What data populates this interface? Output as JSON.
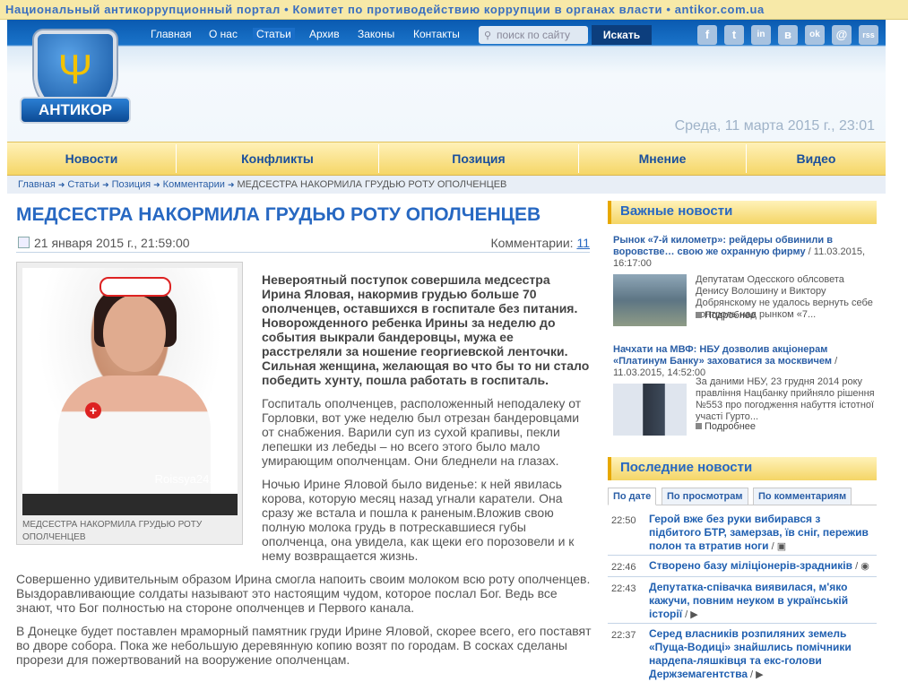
{
  "topstrip": "Национальный антикоррупционный портал • Комитет по противодействию коррупции в органах власти • antikor.com.ua",
  "nav": {
    "items": [
      "Главная",
      "О нас",
      "Статьи",
      "Архив",
      "Законы",
      "Контакты"
    ],
    "active": "Статьи"
  },
  "search": {
    "placeholder": "поиск по сайту",
    "button": "Искать"
  },
  "social": [
    "f",
    "t",
    "in",
    "в",
    "ok",
    "@",
    "rss"
  ],
  "logo": {
    "text": "АНТИКОР"
  },
  "datetime": "Среда, 11 марта 2015 г., 23:01",
  "mainnav": [
    "Новости",
    "Конфликты",
    "Позиция",
    "Мнение",
    "Видео"
  ],
  "breadcrumb": [
    "Главная",
    "Статьи",
    "Позиция",
    "Комментарии",
    "МЕДСЕСТРА НАКОРМИЛА ГРУДЬЮ РОТУ ОПОЛЧЕНЦЕВ"
  ],
  "article": {
    "title": "МЕДСЕСТРА НАКОРМИЛА ГРУДЬЮ РОТУ ОПОЛЧЕНЦЕВ",
    "date": "21 января 2015 г., 21:59:00",
    "comments_label": "Комментарии:",
    "comments_count": "11",
    "photo_watermark": "Roissya24.net",
    "photo_caption": "МЕДСЕСТРА НАКОРМИЛА ГРУДЬЮ РОТУ ОПОЛЧЕНЦЕВ",
    "lead": "Невероятный поступок совершила медсестра Ирина Яловая, накормив грудью больше 70 ополченцев, оставшихся в госпитале без питания. Новорожденного ребенка Ирины за неделю до события выкрали бандеровцы, мужа ее расстреляли за ношение георгиевской ленточки. Сильная женщина, желающая во что бы то ни стало победить хунту, пошла работать в госпиталь.",
    "p1": "Госпиталь ополченцев, расположенный неподалеку от Горловки, вот уже неделю был отрезан бандеровцами от снабжения. Варили суп из сухой крапивы, пекли лепешки из лебеды – но всего этого было мало умирающим ополченцам. Они бледнели на глазах.",
    "p2": "Ночью Ирине Яловой было виденье: к ней явилась корова, которую месяц назад угнали каратели. Она сразу же встала и пошла к раненым.Вложив свою полную молока грудь в потрескавшиеся губы ополченца, она увидела, как щеки его порозовели и к нему возвращается жизнь.",
    "p3": "Совершенно удивительным образом Ирина смогла напоить своим молоком всю роту ополченцев. Выздоравливающие солдаты называют это настоящим чудом, которое послал Бог. Ведь все знают, что Бог полностью на стороне ополченцев и Первого канала.",
    "p4": "В Донецке будет поставлен мраморный памятник груди Ирине Яловой, скорее всего, его поставят во дворе собора. Пока же небольшую деревянную копию возят по городам. В сосках сделаны прорези для пожертвований на вооружение ополченцам."
  },
  "sidebar": {
    "important_title": "Важные новости",
    "important": [
      {
        "title": "Рынок «7-й километр»: рейдеры обвинили в воровстве… свою же охранную фирму",
        "date": " / 11.03.2015, 16:17:00",
        "desc": "Депутатам Одесского облсовета Денису Волошину и Виктору Добрянскому не удалось вернуть себе контроль над рынком «7...",
        "more": "Подробнее"
      },
      {
        "title": "Начхати на МВФ: НБУ дозволив акціонерам «Платинум Банку» заховатися за москвичем",
        "date": " / 11.03.2015, 14:52:00",
        "desc": "За даними НБУ, 23 грудня 2014 року правління Нацбанку прийняло рішення №553 про погодження набуття істотної участі Гурто...",
        "more": "Подробнее"
      }
    ],
    "latest_title": "Последние новости",
    "tabs": [
      "По дате",
      "По просмотрам",
      "По комментариям"
    ],
    "latest": [
      {
        "time": "22:50",
        "text": "Герой вже без руки вибирався з підбитого БТР, замерзав, їв сніг, пережив полон та втратив ноги",
        "icons": " / "
      },
      {
        "time": "22:46",
        "text": "Створено базу міліціонерів-зрадників",
        "icons": " / "
      },
      {
        "time": "22:43",
        "text": "Депутатка-співачка виявилася, м'яко кажучи, повним неуком в українській історії",
        "icons": " / "
      },
      {
        "time": "22:37",
        "text": "Серед власників розпиляних земель «Пуща-Водиці» знайшлись помічники нардепа-ляшківця та екс-голови Держземагентства",
        "icons": " / "
      }
    ]
  }
}
